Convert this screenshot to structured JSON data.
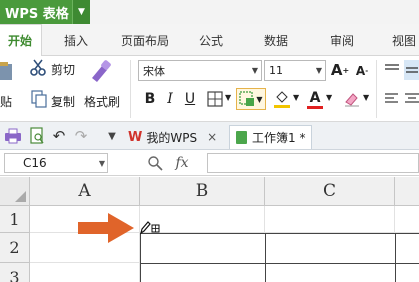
{
  "app": {
    "title": "WPS 表格"
  },
  "tabs": [
    {
      "label": "开始"
    },
    {
      "label": "插入"
    },
    {
      "label": "页面布局"
    },
    {
      "label": "公式"
    },
    {
      "label": "数据"
    },
    {
      "label": "审阅"
    },
    {
      "label": "视图"
    }
  ],
  "ribbon": {
    "cut_label": "剪切",
    "paste_label": "贴",
    "copy_label": "复制",
    "format_painter_label": "格式刷",
    "font_name": "宋体",
    "font_size": "11",
    "font_color": "#e02020",
    "fill_color": "#f2c500"
  },
  "quick_access": {
    "doc_tabs": [
      {
        "label": "我的WPS"
      },
      {
        "label": "工作簿1 *"
      }
    ]
  },
  "formula_bar": {
    "name_box": "C16",
    "fx_label": "fx",
    "value": ""
  },
  "sheet": {
    "columns": [
      "A",
      "B",
      "C"
    ],
    "rows": [
      "1",
      "2",
      "3"
    ]
  },
  "annotation": {
    "arrow_color": "#e0642a"
  }
}
